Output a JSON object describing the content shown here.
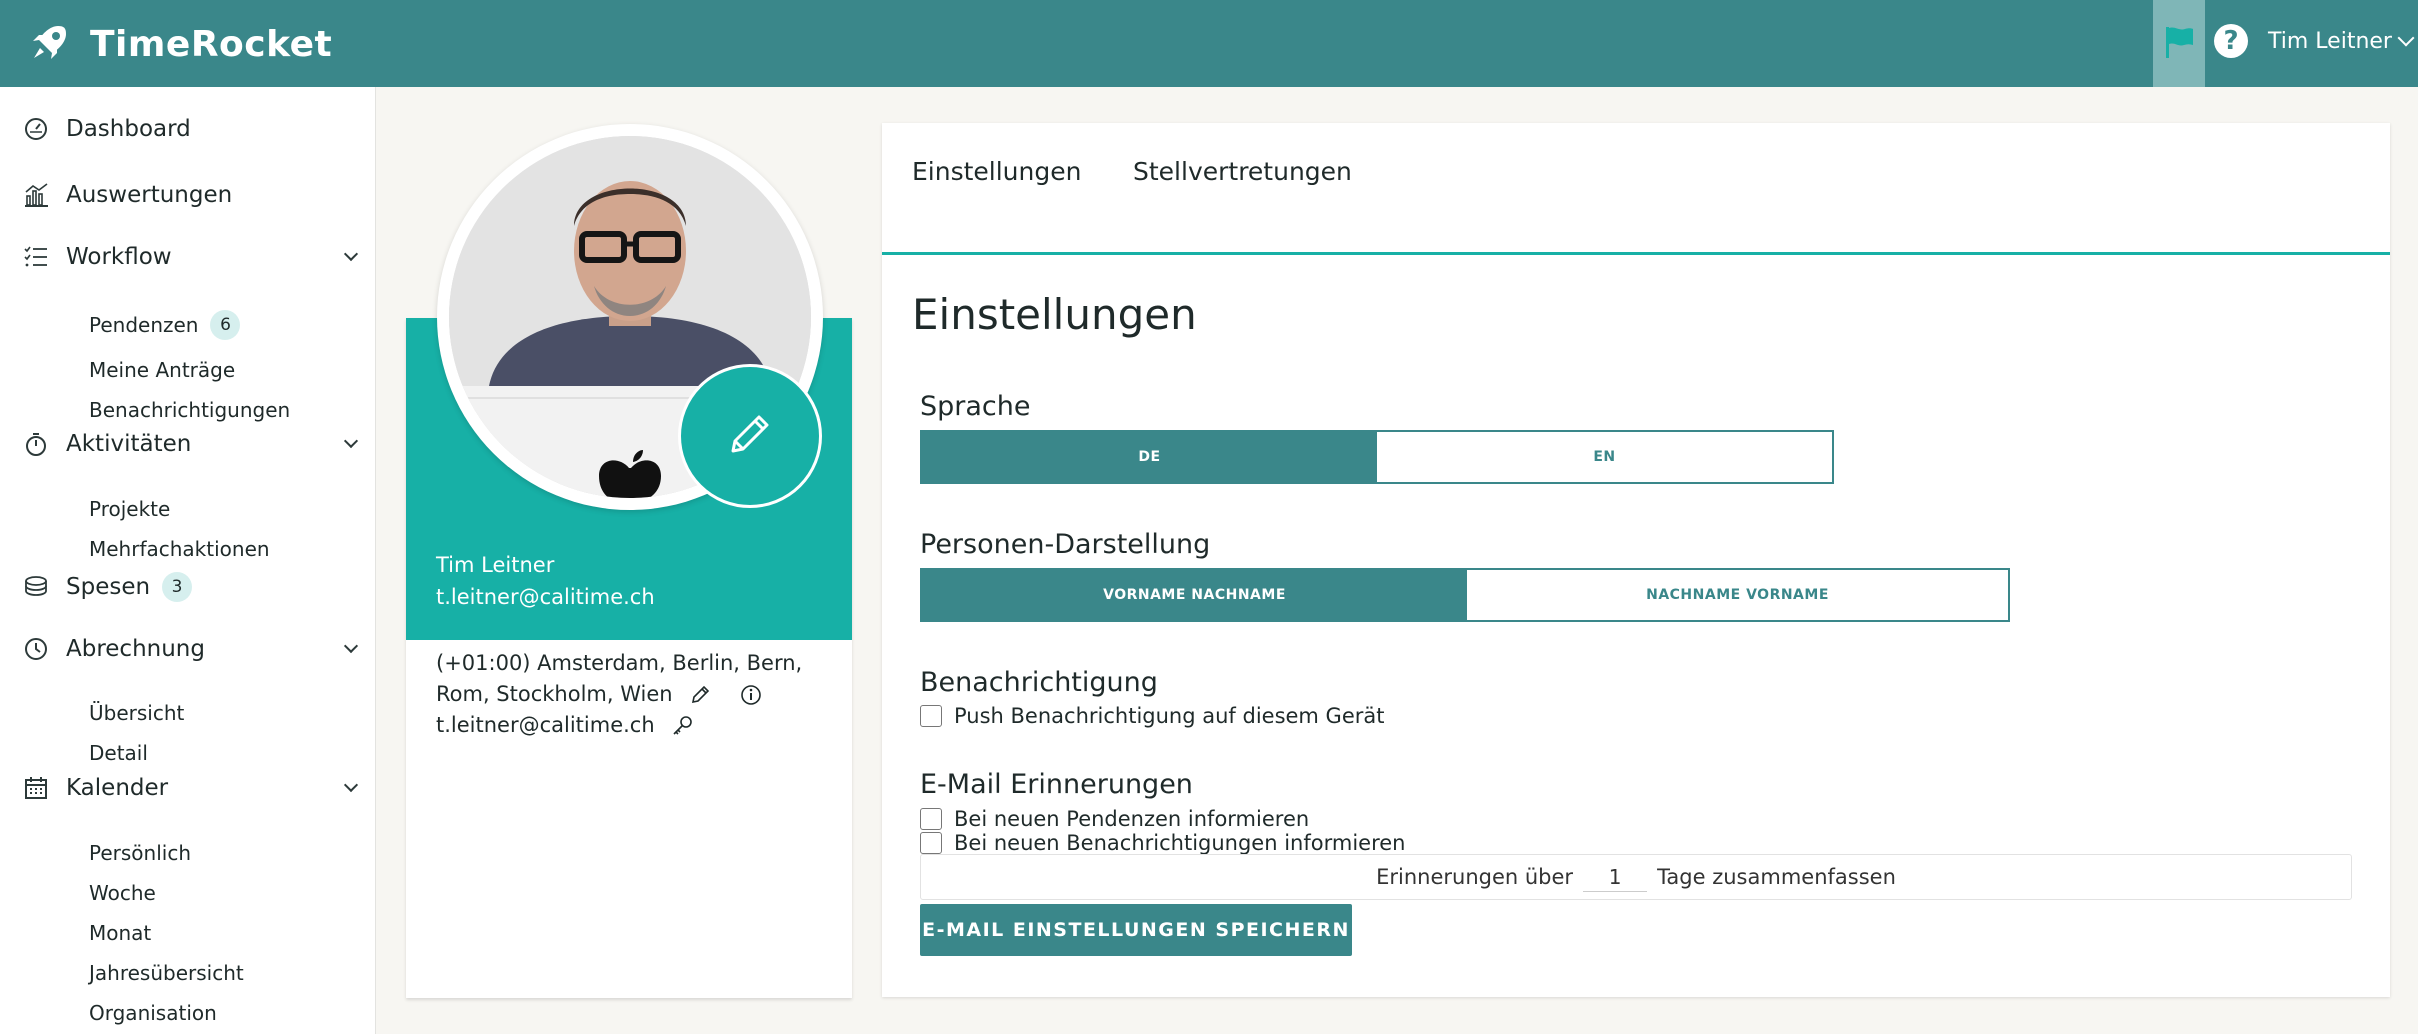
{
  "app": {
    "name": "TimeRocket"
  },
  "header": {
    "user_name": "Tim Leitner",
    "help_glyph": "?"
  },
  "sidebar": {
    "dashboard": "Dashboard",
    "auswertungen": "Auswertungen",
    "workflow": "Workflow",
    "workflow_items": [
      "Pendenzen",
      "Meine Anträge",
      "Benachrichtigungen"
    ],
    "pendenzen_count": "6",
    "aktivitaeten": "Aktivitäten",
    "aktivitaeten_items": [
      "Projekte",
      "Mehrfachaktionen"
    ],
    "spesen": "Spesen",
    "spesen_count": "3",
    "abrechnung": "Abrechnung",
    "abrechnung_items": [
      "Übersicht",
      "Detail"
    ],
    "kalender": "Kalender",
    "kalender_items": [
      "Persönlich",
      "Woche",
      "Monat",
      "Jahresübersicht",
      "Organisation"
    ]
  },
  "profile": {
    "name": "Tim Leitner",
    "email": "t.leitner@calitime.ch",
    "timezone_line1": "(+01:00) Amsterdam, Berlin, Bern,",
    "timezone_line2": "Rom, Stockholm, Wien",
    "login_email": "t.leitner@calitime.ch"
  },
  "tabs": [
    "Einstellungen",
    "Stellvertretungen"
  ],
  "settings": {
    "title": "Einstellungen",
    "sprache_label": "Sprache",
    "sprache_options": [
      "DE",
      "EN"
    ],
    "sprache_selected": "DE",
    "person_label": "Personen-Darstellung",
    "person_options": [
      "VORNAME NACHNAME",
      "NACHNAME VORNAME"
    ],
    "person_selected": "VORNAME NACHNAME",
    "benachrichtigung_label": "Benachrichtigung",
    "push_label": "Push Benachrichtigung auf diesem Gerät",
    "email_label": "E-Mail Erinnerungen",
    "email_opt1": "Bei neuen Pendenzen informieren",
    "email_opt2": "Bei neuen Benachrichtigungen informieren",
    "summary_prefix": "Erinnerungen über",
    "summary_days": "1",
    "summary_suffix": "Tage zusammenfassen",
    "save_label": "E-MAIL EINSTELLUNGEN SPEICHERN"
  },
  "colors": {
    "primary": "#3a878a",
    "accent": "#17b0a6",
    "highlight": "#7fb6b7"
  }
}
